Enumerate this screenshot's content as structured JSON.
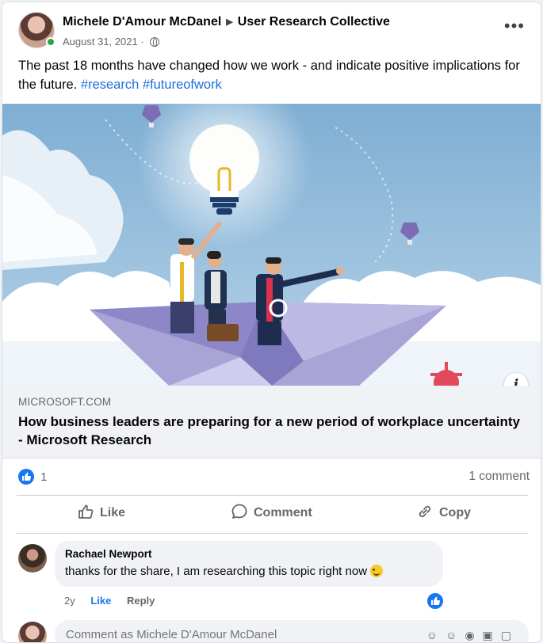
{
  "post": {
    "author": "Michele D'Amour McDanel",
    "group": "User Research Collective",
    "date": "August 31, 2021",
    "separator": "·",
    "text": "The past 18 months have changed how we work - and indicate positive implications for the future.",
    "hashtags": [
      "#research",
      "#futureofwork"
    ],
    "more_label": "•••"
  },
  "link": {
    "domain": "MICROSOFT.COM",
    "title": "How business leaders are preparing for a new period of workplace uncertainty - Microsoft Research",
    "info_label": "i"
  },
  "stats": {
    "like_count": "1",
    "comment_count": "1 comment"
  },
  "actions": {
    "like": "Like",
    "comment": "Comment",
    "copy": "Copy"
  },
  "comment": {
    "author": "Rachael Newport",
    "text": "thanks for the share, I am researching this topic right now",
    "age": "2y",
    "like_label": "Like",
    "reply_label": "Reply"
  },
  "composer": {
    "placeholder": "Comment as Michele D'Amour McDanel"
  },
  "colors": {
    "accent": "#1877f2",
    "hashtag": "#216fdb",
    "online": "#31a24c"
  }
}
